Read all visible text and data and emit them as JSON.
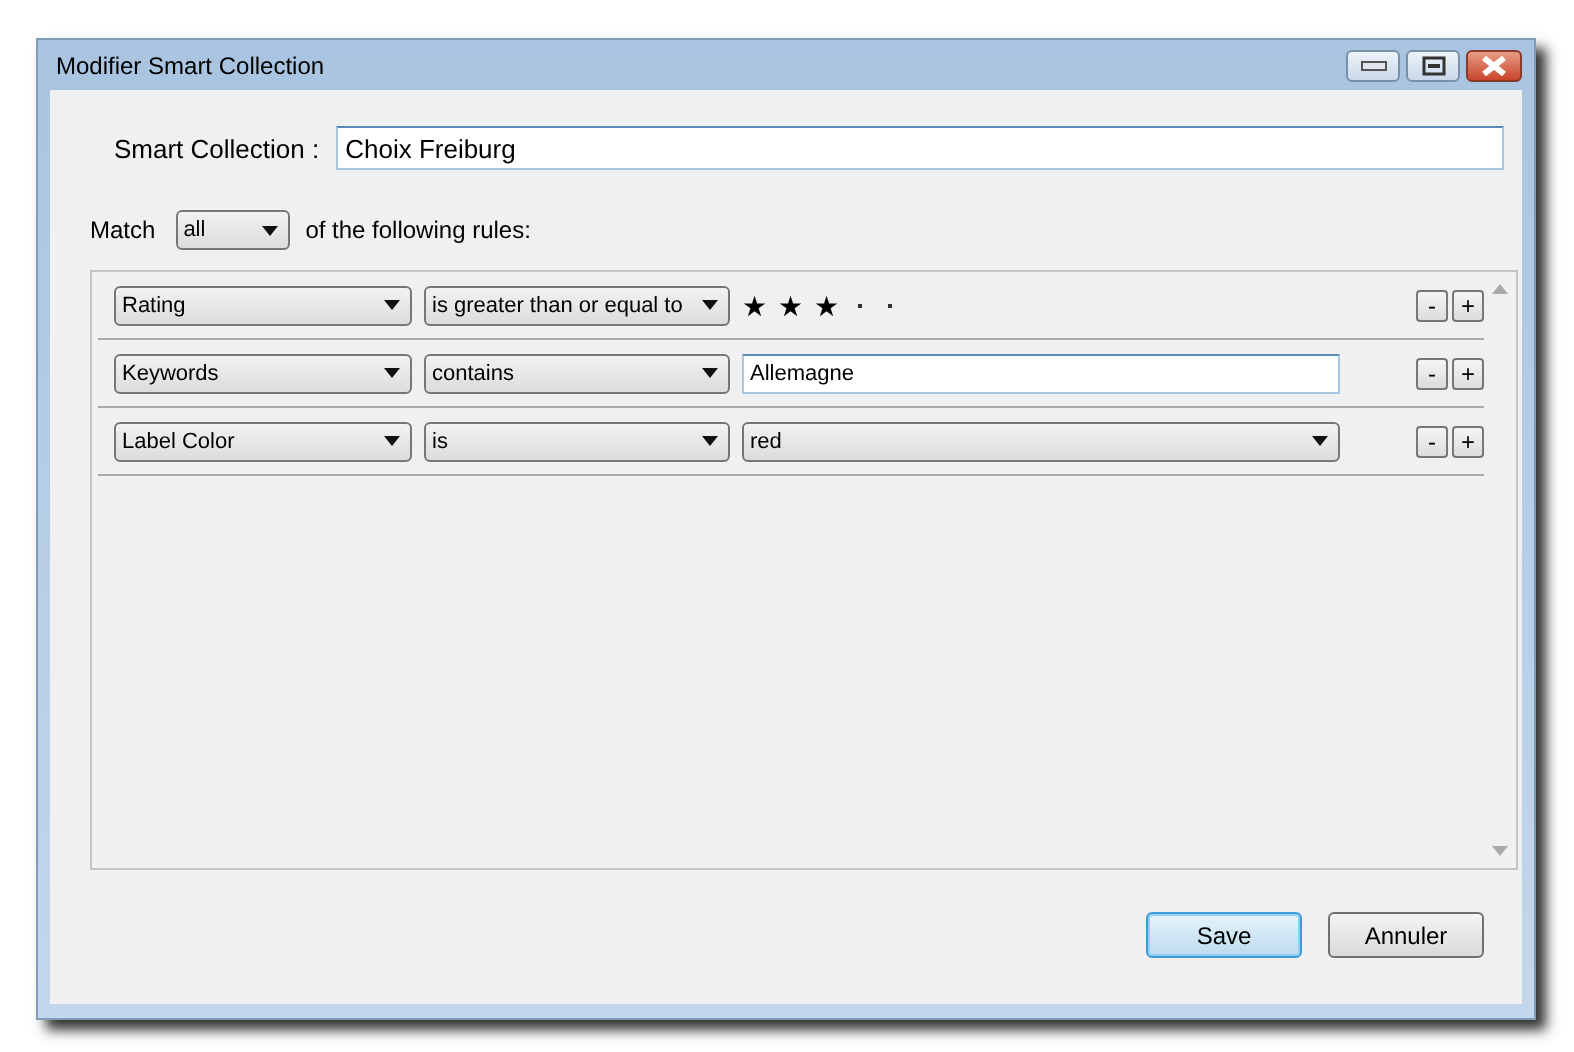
{
  "window": {
    "title": "Modifier Smart Collection"
  },
  "name_field": {
    "label": "Smart Collection :",
    "value": "Choix Freiburg"
  },
  "match": {
    "prefix": "Match",
    "value": "all",
    "suffix": "of the following rules:"
  },
  "rules": [
    {
      "field": "Rating",
      "operator": "is greater than or equal to",
      "kind": "stars",
      "stars": 3,
      "remove_label": "-",
      "add_label": "+"
    },
    {
      "field": "Keywords",
      "operator": "contains",
      "kind": "text",
      "value": "Allemagne",
      "remove_label": "-",
      "add_label": "+"
    },
    {
      "field": "Label Color",
      "operator": "is",
      "kind": "select",
      "value": "red",
      "remove_label": "-",
      "add_label": "+"
    }
  ],
  "buttons": [
    {
      "label": "Save",
      "default": true
    },
    {
      "label": "Annuler",
      "default": false
    }
  ]
}
